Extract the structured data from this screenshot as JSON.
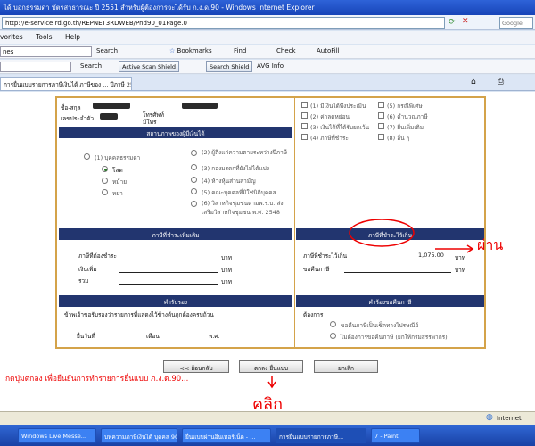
{
  "window": {
    "title": "ได้ บอกธรรมดา บัตรสาธารณะ ปี 2551 สำหรับผู้ต้องการจะได้รับ ก.ง.ด.90 - Windows Internet Explorer"
  },
  "address_bar": {
    "url": "http://e-service.rd.go.th/REPNET3RDWEB/Pnd90_01Page.0",
    "search_placeholder": "Google"
  },
  "menu": [
    "vorites",
    "Tools",
    "Help"
  ],
  "toolbar1": {
    "field": "nes",
    "search": "Search",
    "bookmarks": "Bookmarks",
    "find": "Find",
    "check": "Check",
    "autofill": "AutoFill"
  },
  "toolbar2": {
    "search": "Search",
    "active_btn": "Active Scan Shield",
    "search_shield": "Search Shield",
    "avg": "AVG Info"
  },
  "tab": {
    "label": "การยื่นแบบรายการภาษีเงินได้ ภาษีของ ... ปีภาษี 2551"
  },
  "form": {
    "top_left": {
      "name_label": "ชื่อ-สกุล",
      "id_label": "เลขประจำตัว",
      "phone_label": "โทรศัพท์",
      "phone_value": "มีโทร"
    },
    "right_checks": [
      "(1) มีเงินได้พึงประเมิน",
      "(2) ค่าลดหย่อน",
      "(3) เงินได้ที่ได้รับยกเว้น",
      "(4) ภาษีที่ชำระ",
      "(5) กรณีพิเศษ",
      "(6) คำนวณภาษี",
      "(7) ยื่นเพิ่มเติม",
      "(8) อื่น ๆ"
    ],
    "status_header": "สถานภาพของผู้มีเงินได้",
    "status_left": [
      "(1) บุคคลธรรมดา",
      "โสด",
      "หม้าย",
      "หย่า"
    ],
    "status_right": [
      "(2) ผู้ถึงแก่ความตายระหว่างปีภาษี",
      "(3) กองมรดกที่ยังไม่ได้แบ่ง",
      "(4) ห้างหุ้นส่วนสามัญ",
      "(5) คณะบุคคลที่มิใช่นิติบุคคล",
      "(6) วิสาหกิจชุมชนตามพ.ร.บ. ส่งเสริมวิสาหกิจชุมชน พ.ศ. 2548"
    ],
    "left_tax_header": "ภาษีที่ชำระเพิ่มเติม",
    "right_tax_header": "ภาษีที่ชำระไว้เกิน",
    "left_tax_rows": [
      "ภาษีที่ต้องชำระ",
      "เงินเพิ่ม",
      "รวม"
    ],
    "right_tax_rows": [
      "ภาษีที่ชำระไว้เกิน",
      "ขอคืนภาษี"
    ],
    "right_amount": "1,075.00",
    "unit": "บาท",
    "left_section_header": "คำรับรอง",
    "left_section_text": "ข้าพเจ้าขอรับรองว่ารายการที่แสดงไว้ข้างต้นถูกต้องครบถ้วน",
    "date_labels": [
      "ยื่นวันที่",
      "เดือน",
      "พ.ศ."
    ],
    "right_section_header": "คำร้องขอคืนภาษี",
    "right_section_sub": "ต้องการ",
    "right_section_options": [
      "ขอคืนภาษีเป็นเช็คทางไปรษณีย์",
      "ไม่ต้องการขอคืนภาษี (ยกให้กรมสรรพากร)"
    ],
    "buttons": [
      "<< ย้อนกลับ",
      "ตกลง ยื่นแบบ",
      "ยกเลิก"
    ]
  },
  "annotations": {
    "instruction": "กดปุ่มตกลง เพื่อยืนยันการทำรายการยื่นแบบ ภ.ง.ด.90...",
    "pass_note": "ผ่าน",
    "click_note": "คลิก"
  },
  "statusbar": {
    "zone": "Internet"
  },
  "taskbar": [
    "Windows Live Messe...",
    "บทความภาษีเงินได้ บุคคล 90...",
    "ยื่นแบบผ่านอินเทอร์เน็ต - ...",
    "การยื่นแบบรายการภาษี...",
    "7 - Paint"
  ],
  "colors": {
    "form_border": "#d4a34a",
    "section_header": "#22356f",
    "annotation_red": "#e00000"
  }
}
